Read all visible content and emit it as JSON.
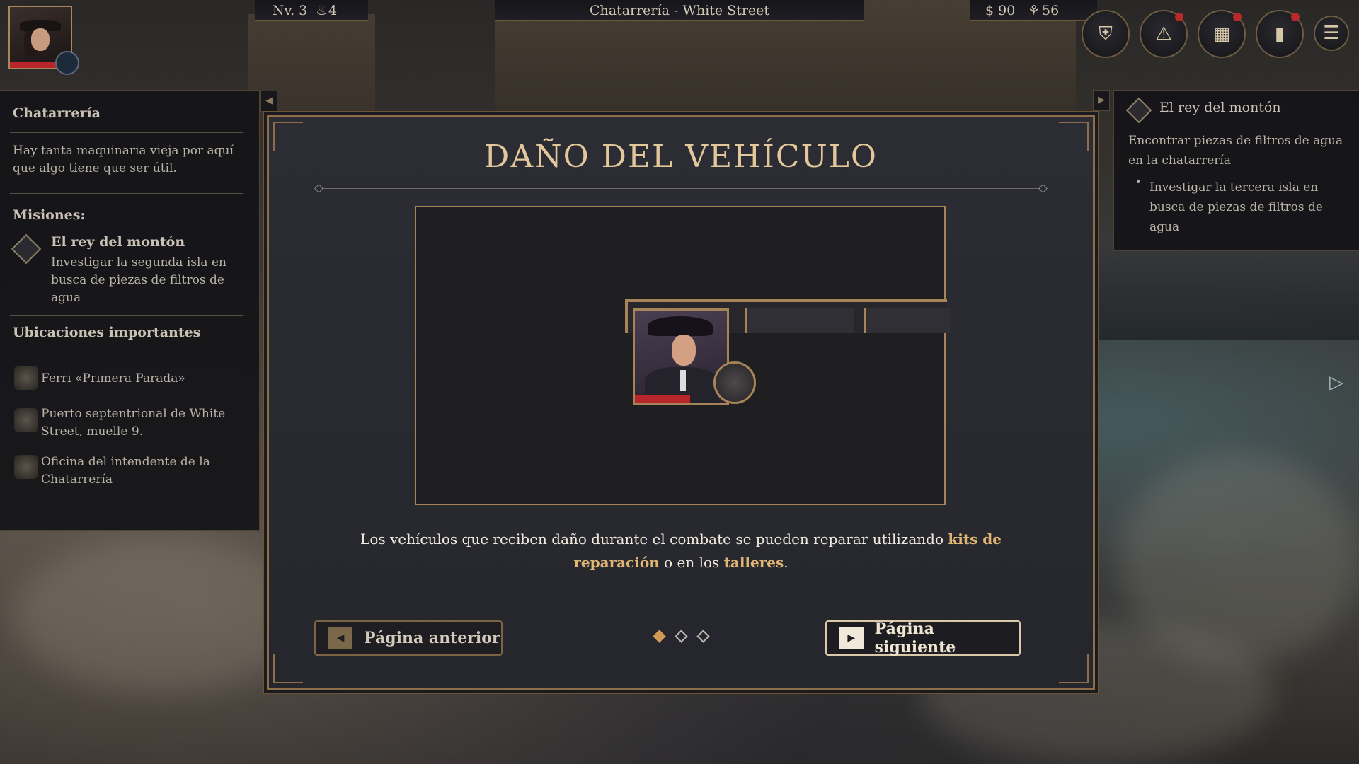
{
  "top_bar": {
    "level": "Nv. 3",
    "energy": "4",
    "location": "Chatarrería - White Street",
    "money": "$ 90",
    "resource": "56"
  },
  "top_icons": [
    "guild-icon",
    "alert-icon",
    "grid-icon",
    "journal-icon",
    "menu-icon"
  ],
  "left_panel": {
    "title": "Chatarrería",
    "description": "Hay tanta maquinaria vieja por aquí que algo tiene que ser útil.",
    "missions_label": "Misiones:",
    "mission": {
      "name": "El rey del montón",
      "text": "Investigar la segunda isla en busca de piezas de filtros de agua"
    },
    "locations_label": "Ubicaciones importantes",
    "locations": [
      "Ferri «Primera Parada»",
      "Puerto septentrional de White Street, muelle 9.",
      "Oficina del intendente de la Chatarrería"
    ]
  },
  "right_panel": {
    "quest_title": "El rey del montón",
    "objective": "Encontrar piezas de filtros de agua en la chatarrería",
    "bullet": "Investigar la tercera isla en busca de piezas de filtros de agua"
  },
  "modal": {
    "title": "DAÑO DEL VEHÍCULO",
    "desc_before": "Los vehículos que reciben daño durante el combate se pueden reparar utilizando ",
    "desc_hl1": "kits de reparación",
    "desc_mid": " o en los ",
    "desc_hl2": "talleres",
    "desc_after": ".",
    "prev_label": "Página anterior",
    "next_label": "Página siguiente",
    "page_count": 3,
    "current_page": 1
  },
  "colors": {
    "gold": "#a68458",
    "highlight": "#e0b574",
    "health": "#b8262c"
  }
}
